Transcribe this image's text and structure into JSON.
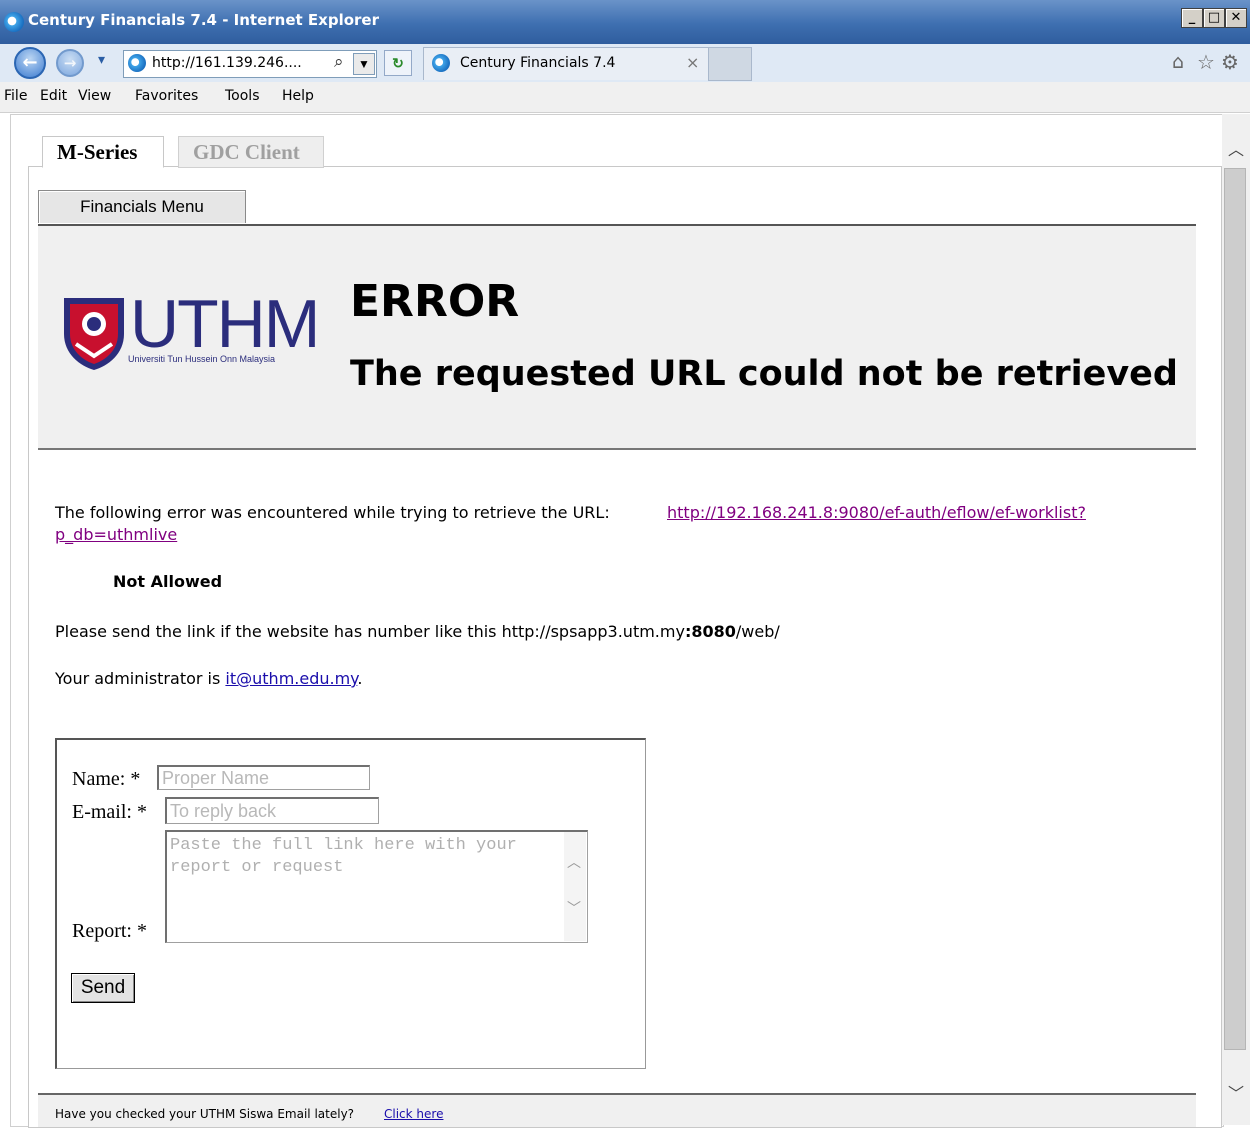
{
  "window": {
    "title": "Century Financials 7.4 - Internet Explorer",
    "controls": {
      "minimize": "_",
      "maximize": "□",
      "close": "✕"
    }
  },
  "nav": {
    "address": "http://161.139.246....",
    "search_glyph": "⌕",
    "dropdown_glyph": "▾",
    "tab_title": "Century Financials 7.4",
    "tab_close": "×"
  },
  "menu": {
    "items": [
      "File",
      "Edit",
      "View",
      "Favorites",
      "Tools",
      "Help"
    ]
  },
  "app_tabs": {
    "active": "M-Series",
    "inactive": "GDC Client"
  },
  "financials_menu": "Financials Menu",
  "logo": {
    "text": "UTHM",
    "subtitle": "Universiti Tun Hussein Onn Malaysia"
  },
  "error": {
    "heading": "ERROR",
    "subheading": "The requested URL could not be retrieved",
    "intro": "The following error was encountered while trying to retrieve the URL:",
    "url_line1": "http://192.168.241.8:9080/ef-auth/eflow/ef-worklist?",
    "url_line2": "p_db=uthmlive",
    "status": "Not Allowed",
    "note_prefix": "Please send the link if the website has number like this http://spsapp3.utm.my",
    "note_bold": ":8080",
    "note_suffix": "/web/",
    "admin_prefix": "Your administrator is",
    "admin_email": "it@uthm.edu.my",
    "admin_suffix": "."
  },
  "form": {
    "name_label": "Name:",
    "name_placeholder": "Proper Name",
    "email_label": "E-mail:",
    "email_placeholder": "To reply back",
    "report_label": "Report:",
    "report_placeholder": "Paste the full link here with your report or request",
    "required_mark": "*",
    "send_label": "Send"
  },
  "footer": {
    "text": "Have you checked your UTHM Siswa Email lately?",
    "link": "Click here"
  },
  "colors": {
    "titlebar": "#3e6fb0",
    "logo_navy": "#2b2d7c",
    "logo_red": "#c8102e",
    "link": "#1a0dab",
    "visited": "#800080"
  }
}
